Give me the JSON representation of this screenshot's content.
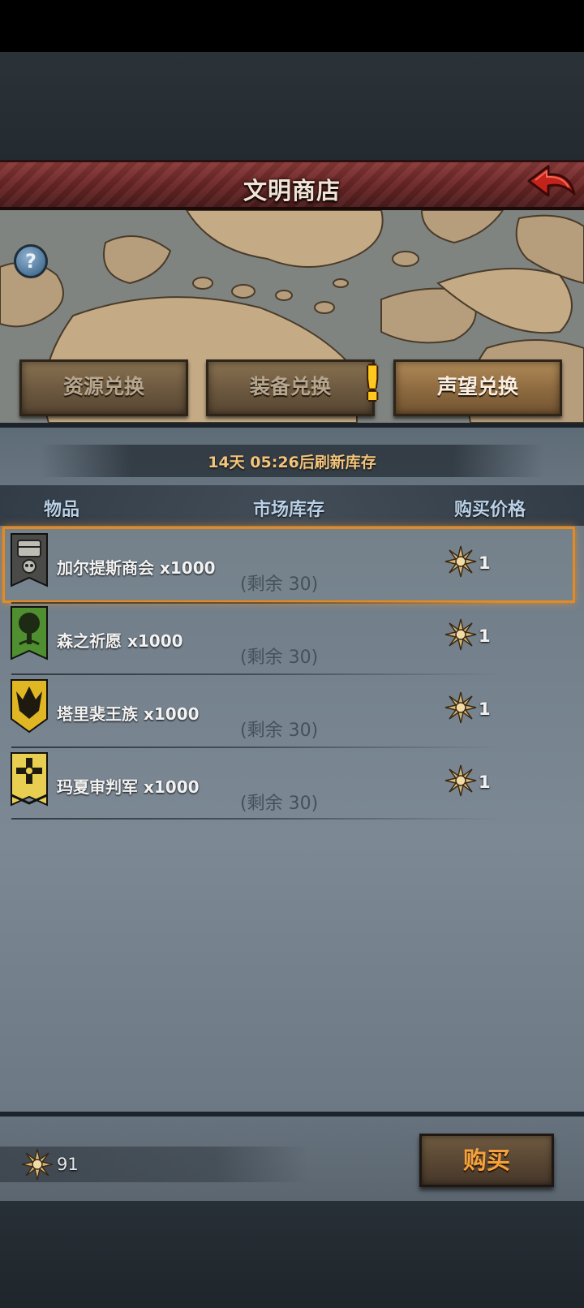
{
  "header": {
    "title": "文明商店",
    "back_icon": "back-arrow-icon",
    "help_label": "?"
  },
  "tabs": [
    {
      "label": "资源兑换",
      "active": false
    },
    {
      "label": "装备兑换",
      "active": false,
      "alert": "!"
    },
    {
      "label": "声望兑换",
      "active": true
    }
  ],
  "refresh_text": "14天 05:26后刷新库存",
  "columns": {
    "item": "物品",
    "stock": "市场库存",
    "price": "购买价格"
  },
  "items": [
    {
      "name": "加尔提斯商会 x1000",
      "stock": "(剩余 30)",
      "price": "1",
      "banner_color": "#4a4a48",
      "emblem": "chest-skull-icon",
      "selected": true
    },
    {
      "name": "森之祈愿 x1000",
      "stock": "(剩余 30)",
      "price": "1",
      "banner_color": "#4f8f2f",
      "emblem": "tree-icon",
      "selected": false
    },
    {
      "name": "塔里裴王族 x1000",
      "stock": "(剩余 30)",
      "price": "1",
      "banner_color": "#e0b623",
      "emblem": "eagle-crest-icon",
      "selected": false
    },
    {
      "name": "玛夏审判军 x1000",
      "stock": "(剩余 30)",
      "price": "1",
      "banner_color": "#e8cf52",
      "emblem": "cross-shield-icon",
      "selected": false
    }
  ],
  "currency_icon": "reputation-star-icon",
  "balance": "91",
  "buy_label": "购买",
  "colors": {
    "title_bar": "#6f2828",
    "highlight": "#e88a1a",
    "refresh_text": "#f3c47c",
    "buy_text": "#f6a23c"
  }
}
